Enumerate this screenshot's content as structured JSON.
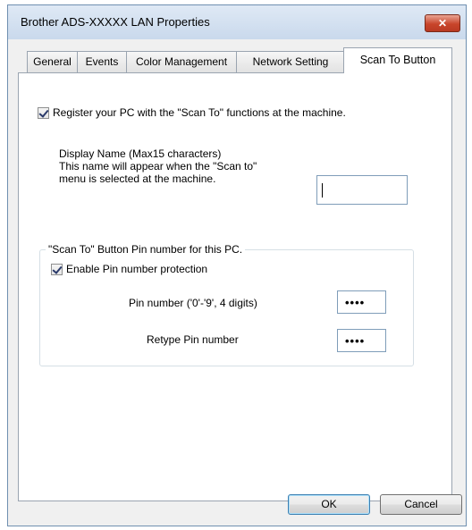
{
  "window": {
    "title": "Brother ADS-XXXXX LAN Properties",
    "close_label": "✕"
  },
  "tabs": [
    {
      "label": "General"
    },
    {
      "label": "Events"
    },
    {
      "label": "Color Management"
    },
    {
      "label": "Network Setting"
    },
    {
      "label": "Scan To Button"
    }
  ],
  "register": {
    "label": "Register your PC with the \"Scan To\" functions at the machine.",
    "checked": true
  },
  "display_name": {
    "line1": "Display Name (Max15 characters)",
    "line2": "This name will appear when the \"Scan to\"",
    "line3": "menu is selected at the machine.",
    "value": ""
  },
  "pin_group": {
    "legend": "\"Scan To\" Button Pin number for this PC.",
    "enable_label": "Enable Pin number protection",
    "enable_checked": true,
    "pin_label": "Pin number ('0'-'9', 4 digits)",
    "pin_value": "••••",
    "retype_label": "Retype Pin number",
    "retype_value": "••••"
  },
  "buttons": {
    "ok": "OK",
    "cancel": "Cancel"
  }
}
